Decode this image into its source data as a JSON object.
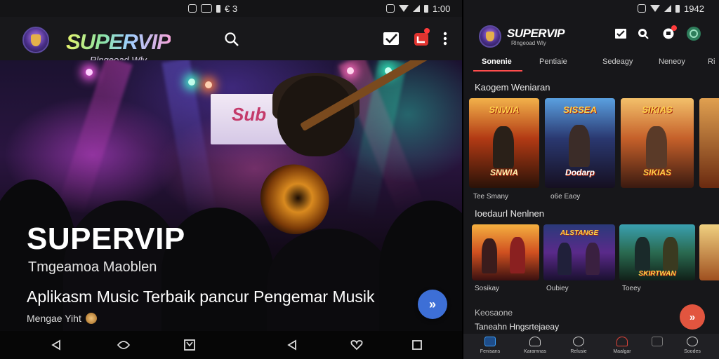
{
  "left": {
    "status": {
      "left_icons_text": "€ 3",
      "time": "1:00"
    },
    "appbar": {
      "logo": "SUPERVIP",
      "logo_sub": "Rlngeoad Wly"
    },
    "hero": {
      "stage_screen_text": "Sub",
      "title": "SUPERVIP",
      "subtitle": "Tmgeamoa Maoblen",
      "tagline": "Aplikasm Music Terbaik pancur Pengemar Musik",
      "meta": "Mengae Yiht",
      "fab_symbol": "»"
    },
    "navbar": {
      "icons": [
        "back-icon",
        "home-icon",
        "recents-icon",
        "back-icon",
        "heart-icon",
        "square-icon"
      ]
    }
  },
  "right": {
    "status": {
      "time": "1942"
    },
    "appbar": {
      "logo": "SUPERVIP",
      "logo_sub": "Rlngeoad Wly"
    },
    "tabs": [
      "Sonenie",
      "Pentiaie",
      "Sedeagy",
      "Neneoy",
      "Ri"
    ],
    "sections": [
      {
        "title": "Kaogem Weniaran",
        "cards": [
          {
            "title": "SNWIA",
            "caption": "Tee Smany"
          },
          {
            "title": "SISSEA",
            "caption": "o6e Eaoy"
          },
          {
            "title": "SIKIAS",
            "caption": ""
          }
        ]
      },
      {
        "title": "Ioedaurl Nenlnen",
        "cards": [
          {
            "title": "",
            "caption": "Sosikay"
          },
          {
            "title": "ALSTANGE",
            "caption": "Oubiey"
          },
          {
            "title": "SKIRTWAN",
            "caption": "Toeey"
          }
        ]
      }
    ],
    "footer_section": {
      "title": "Keosaone",
      "subtitle": "Taneahn Hngsrtejaeay"
    },
    "bottom_nav": [
      "Fenisans",
      "Karamnas",
      "Relusie",
      "Maalgar",
      "",
      "Soodes"
    ],
    "fab_symbol": "»",
    "colors": {
      "accent": "#ff4d4d",
      "fab": "#e2553f",
      "active_nav": "#3aa0ff"
    }
  }
}
